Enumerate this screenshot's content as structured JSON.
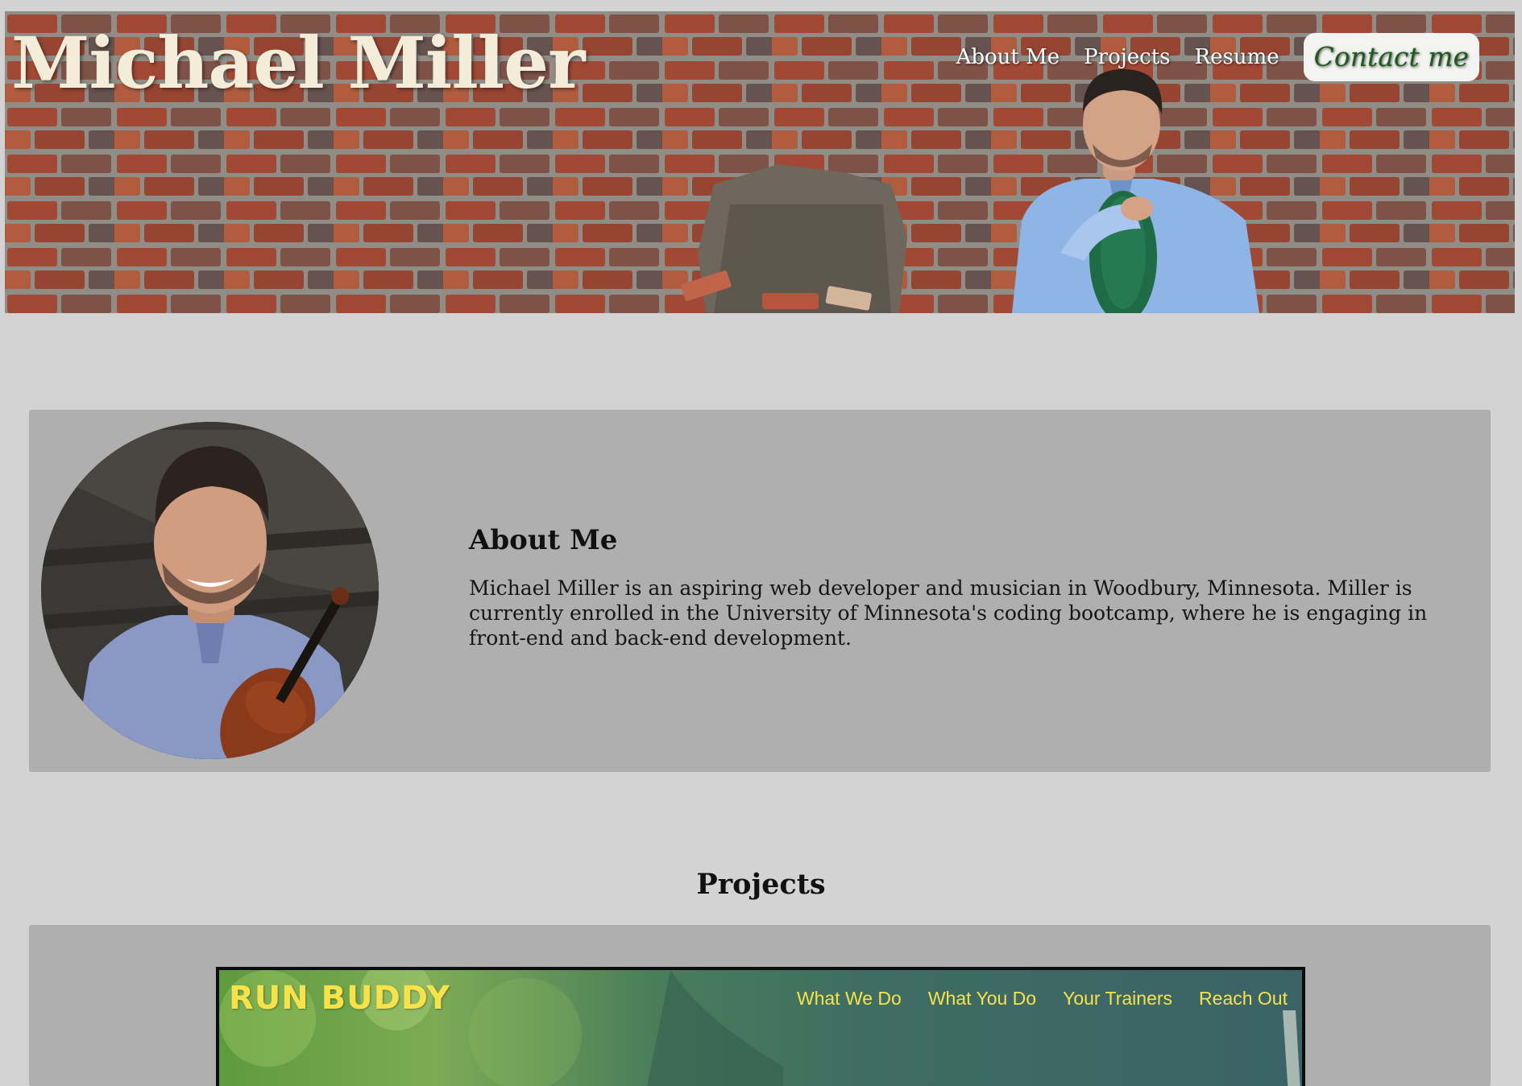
{
  "header": {
    "site_title": "Michael Miller",
    "nav": {
      "about": "About Me",
      "projects": "Projects",
      "resume": "Resume",
      "contact": "Contact me"
    }
  },
  "about": {
    "heading": "About Me",
    "body": "Michael Miller is an aspiring web developer and musician in Woodbury, Minnesota. Miller is currently enrolled in the University of Minnesota's coding bootcamp, where he is engaging in front-end and back-end development."
  },
  "projects": {
    "heading": "Projects",
    "items": [
      {
        "logo_text": "RUN BUDDY",
        "nav": [
          "What We Do",
          "What You Do",
          "Your Trainers",
          "Reach Out"
        ]
      }
    ]
  },
  "colors": {
    "page_bg": "#d3d3d3",
    "panel_bg": "#afafaf",
    "title_text": "#f2ecd9",
    "contact_text": "#1f5b1f",
    "runbuddy_yellow": "#f7e24a"
  }
}
